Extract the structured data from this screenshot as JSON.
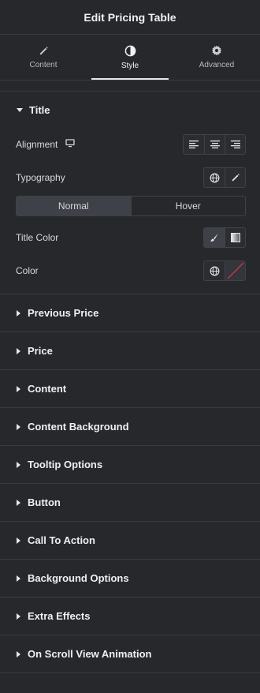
{
  "header": {
    "title": "Edit Pricing Table"
  },
  "tabs": [
    {
      "label": "Content",
      "icon": "pencil-icon"
    },
    {
      "label": "Style",
      "icon": "contrast-icon",
      "active": true
    },
    {
      "label": "Advanced",
      "icon": "gear-icon"
    }
  ],
  "title_section": {
    "label": "Title",
    "alignment_label": "Alignment",
    "typography_label": "Typography",
    "state_tabs": {
      "normal": "Normal",
      "hover": "Hover"
    },
    "title_color_label": "Title Color",
    "color_label": "Color"
  },
  "sections": [
    "Previous Price",
    "Price",
    "Content",
    "Content Background",
    "Tooltip Options",
    "Button",
    "Call To Action",
    "Background Options",
    "Extra Effects",
    "On Scroll View Animation"
  ],
  "colors": {
    "panel_bg": "#26282c",
    "border": "#3a3c41",
    "active_control": "#3e4147",
    "clear_slash": "#c9374a"
  }
}
